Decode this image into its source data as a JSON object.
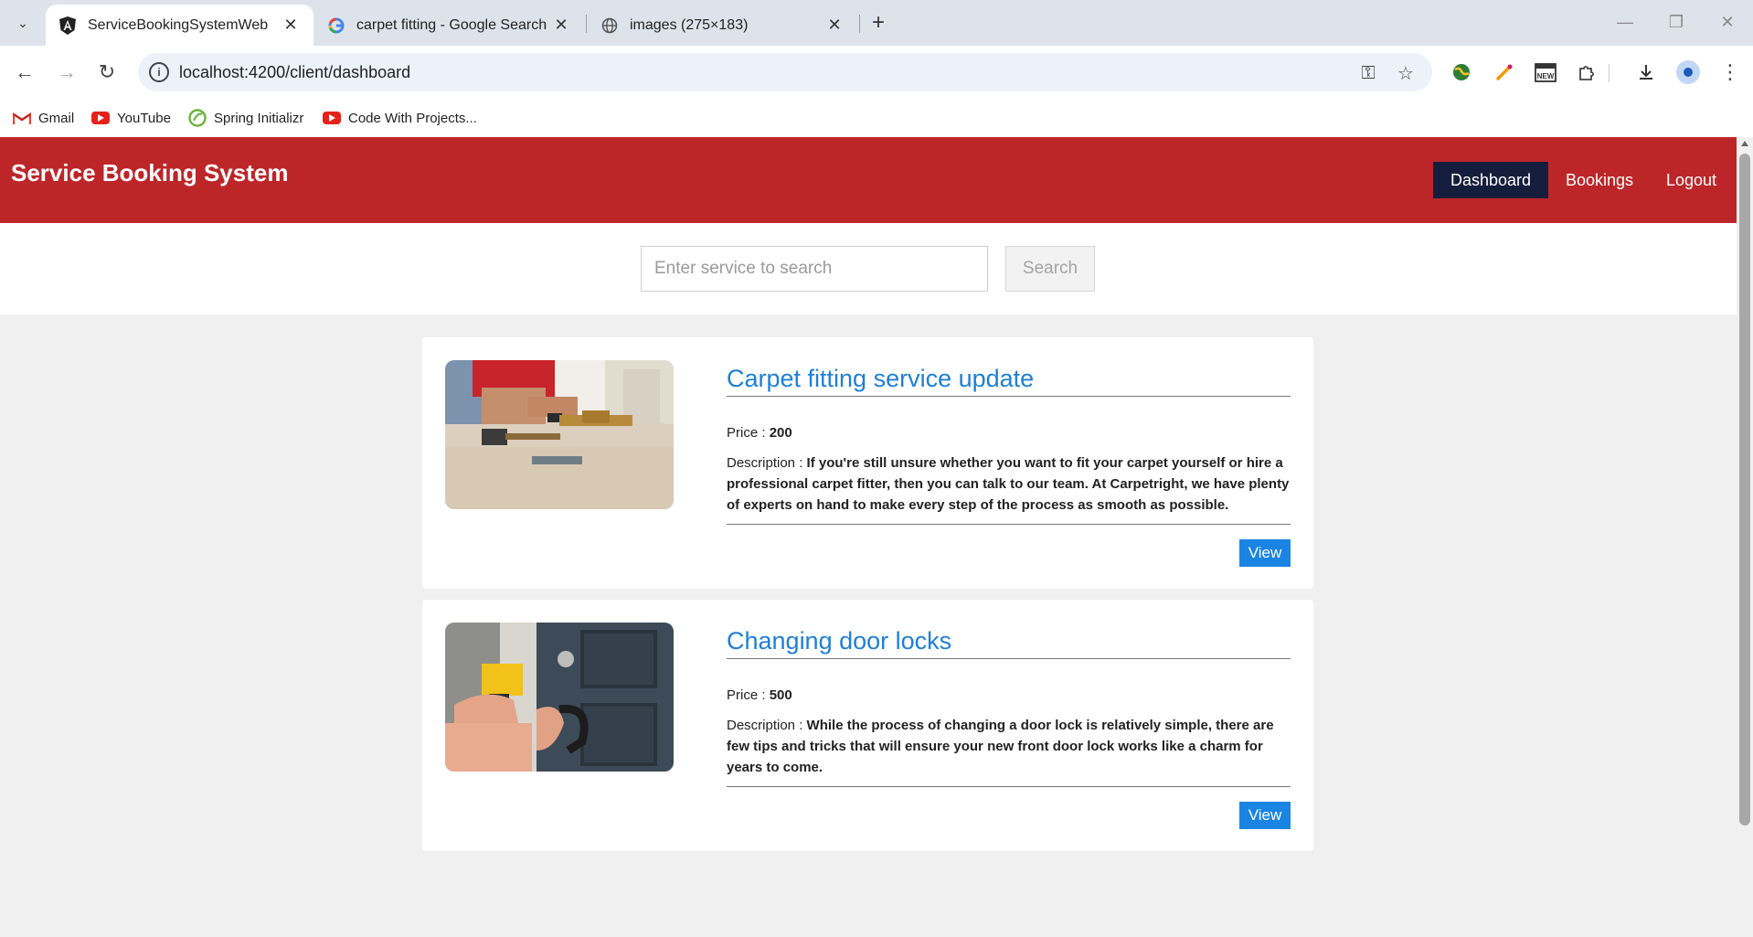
{
  "browser": {
    "tabs": [
      {
        "title": "ServiceBookingSystemWeb",
        "icon": "angular-icon",
        "active": true
      },
      {
        "title": "carpet fitting - Google Search",
        "icon": "google-icon",
        "active": false
      },
      {
        "title": "images (275×183)",
        "icon": "globe-icon",
        "active": false
      }
    ],
    "url": "localhost:4200/client/dashboard",
    "bookmarks": [
      {
        "label": "Gmail",
        "icon": "gmail-icon"
      },
      {
        "label": "YouTube",
        "icon": "youtube-icon"
      },
      {
        "label": "Spring Initializr",
        "icon": "spring-icon"
      },
      {
        "label": "Code With Projects...",
        "icon": "youtube-icon"
      }
    ]
  },
  "app": {
    "title": "Service Booking System",
    "nav": [
      {
        "label": "Dashboard",
        "active": true
      },
      {
        "label": "Bookings",
        "active": false
      },
      {
        "label": "Logout",
        "active": false
      }
    ],
    "search": {
      "placeholder": "Enter service to search",
      "button_label": "Search"
    },
    "price_label": "Price :",
    "description_label": "Description :",
    "view_label": "View",
    "services": [
      {
        "title": "Carpet fitting service update",
        "price": "200",
        "description": "If you're still unsure whether you want to fit your carpet yourself or hire a professional carpet fitter, then you can talk to our team. At Carpetright, we have plenty of experts on hand to make every step of the process as smooth as possible.",
        "image": "carpet-fitting-photo"
      },
      {
        "title": "Changing door locks",
        "price": "500",
        "description": "While the process of changing a door lock is relatively simple, there are few tips and tricks that will ensure your new front door lock works like a charm for years to come.",
        "image": "door-lock-photo"
      }
    ]
  },
  "colors": {
    "header_bg": "#bd2629",
    "nav_active_bg": "#141e3c",
    "title_blue": "#1e7fd6",
    "view_button": "#1a84e3"
  }
}
